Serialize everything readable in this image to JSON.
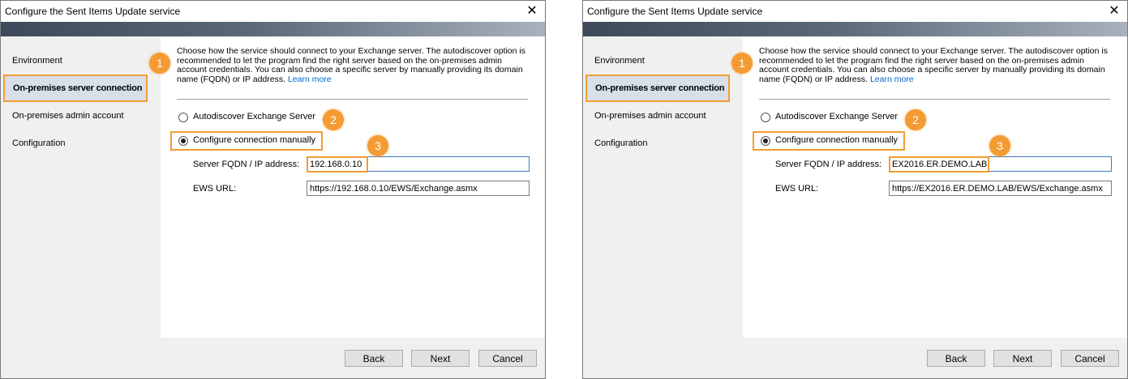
{
  "dialogs": [
    {
      "title": "Configure the Sent Items Update service",
      "nav": [
        "Environment",
        "On-premises server connection",
        "On-premises admin account",
        "Configuration"
      ],
      "description": "Choose how the service should connect to your Exchange server. The autodiscover option is recommended to let the program find the right server based on the on-premises admin account credentials. You can also choose a specific server by manually providing its domain name (FQDN) or IP address.",
      "learn_more": "Learn more",
      "option_autodiscover": "Autodiscover Exchange Server",
      "option_manual": "Configure connection manually",
      "server_label": "Server FQDN / IP address:",
      "server_value": "192.168.0.10",
      "ews_label": "EWS URL:",
      "ews_value": "https://192.168.0.10/EWS/Exchange.asmx",
      "badges": [
        "1",
        "2",
        "3"
      ],
      "buttons": {
        "back": "Back",
        "next": "Next",
        "cancel": "Cancel"
      }
    },
    {
      "title": "Configure the Sent Items Update service",
      "nav": [
        "Environment",
        "On-premises server connection",
        "On-premises admin account",
        "Configuration"
      ],
      "description": "Choose how the service should connect to your Exchange server. The autodiscover option is recommended to let the program find the right server based on the on-premises admin account credentials. You can also choose a specific server by manually providing its domain name (FQDN) or IP address.",
      "learn_more": "Learn more",
      "option_autodiscover": "Autodiscover Exchange Server",
      "option_manual": "Configure connection manually",
      "server_label": "Server FQDN / IP address:",
      "server_value": "EX2016.ER.DEMO.LAB",
      "ews_label": "EWS URL:",
      "ews_value": "https://EX2016.ER.DEMO.LAB/EWS/Exchange.asmx",
      "badges": [
        "1",
        "2",
        "3"
      ],
      "buttons": {
        "back": "Back",
        "next": "Next",
        "cancel": "Cancel"
      }
    }
  ],
  "colors": {
    "highlight": "#f39c34",
    "link": "#0066cc",
    "selected_nav_bg": "#d7dfe9"
  },
  "icons": {
    "close": "close-icon"
  }
}
